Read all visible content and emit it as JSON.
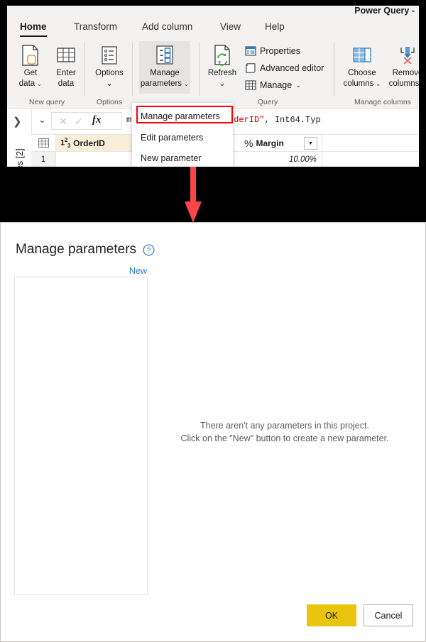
{
  "window": {
    "title": "Power Query -"
  },
  "ribbon": {
    "tabs": [
      {
        "label": "Home",
        "active": true
      },
      {
        "label": "Transform",
        "active": false
      },
      {
        "label": "Add column",
        "active": false
      },
      {
        "label": "View",
        "active": false
      },
      {
        "label": "Help",
        "active": false
      }
    ],
    "groups": [
      {
        "label": "New query",
        "buttons": [
          {
            "label_line1": "Get",
            "label_line2": "data",
            "chevron": true,
            "icon": "get-data-icon"
          },
          {
            "label_line1": "Enter",
            "label_line2": "data",
            "chevron": false,
            "icon": "enter-data-icon"
          }
        ]
      },
      {
        "label": "Options",
        "buttons": [
          {
            "label_line1": "Options",
            "label_line2": "",
            "chevron": true,
            "icon": "options-icon"
          }
        ]
      },
      {
        "label": "",
        "buttons": [
          {
            "label_line1": "Manage",
            "label_line2": "parameters",
            "chevron": true,
            "icon": "manage-parameters-icon",
            "selected": true
          }
        ]
      },
      {
        "label": "Query",
        "buttons": [
          {
            "label_line1": "Refresh",
            "label_line2": "",
            "chevron": true,
            "icon": "refresh-icon"
          }
        ],
        "small_buttons": [
          {
            "label": "Properties",
            "icon": "properties-icon",
            "chevron": false
          },
          {
            "label": "Advanced editor",
            "icon": "advanced-editor-icon",
            "chevron": false
          },
          {
            "label": "Manage",
            "icon": "manage-icon",
            "chevron": true
          }
        ]
      },
      {
        "label": "Manage columns",
        "buttons": [
          {
            "label_line1": "Choose",
            "label_line2": "columns",
            "chevron": true,
            "icon": "choose-columns-icon"
          },
          {
            "label_line1": "Remove",
            "label_line2": "columns",
            "chevron": true,
            "icon": "remove-columns-icon"
          }
        ]
      }
    ]
  },
  "dropdown": {
    "items": [
      {
        "label": "Manage parameters",
        "highlighted": true
      },
      {
        "label": "Edit parameters",
        "highlighted": false
      },
      {
        "label": "New parameter",
        "highlighted": false
      }
    ],
    "highlight_color": "#ff0000"
  },
  "formula_bar": {
    "expander_icon": "chevron-right-icon",
    "caret_icon": "chevron-down-icon",
    "cancel_icon": "cancel-icon",
    "accept_icon": "check-icon",
    "fx_icon": "fx-icon",
    "formula_prefix": "mnTypes(Source, {{",
    "formula_string": "\"OrderID\"",
    "formula_suffix": ", Int64.Typ"
  },
  "left_rail": {
    "label": "es [2]"
  },
  "grid": {
    "columns": [
      {
        "name": "OrderID",
        "type_glyph": "123",
        "highlighted": true
      },
      {
        "name": "Margin",
        "type_glyph": "%",
        "has_filter": true
      }
    ],
    "rows": [
      {
        "row_number": "1",
        "orderid": "",
        "margin": "10.00%"
      }
    ]
  },
  "arrow": {
    "name": "red-down-arrow",
    "color": "#fa4646"
  },
  "dialog": {
    "title": "Manage parameters",
    "help_icon": "help-circle-icon",
    "new_link": "New",
    "empty_state_line1": "There aren't any parameters in this project.",
    "empty_state_line2": "Click on the \"New\" button to create a new parameter.",
    "ok_label": "OK",
    "cancel_label": "Cancel",
    "ok_color": "#e9c40f"
  }
}
